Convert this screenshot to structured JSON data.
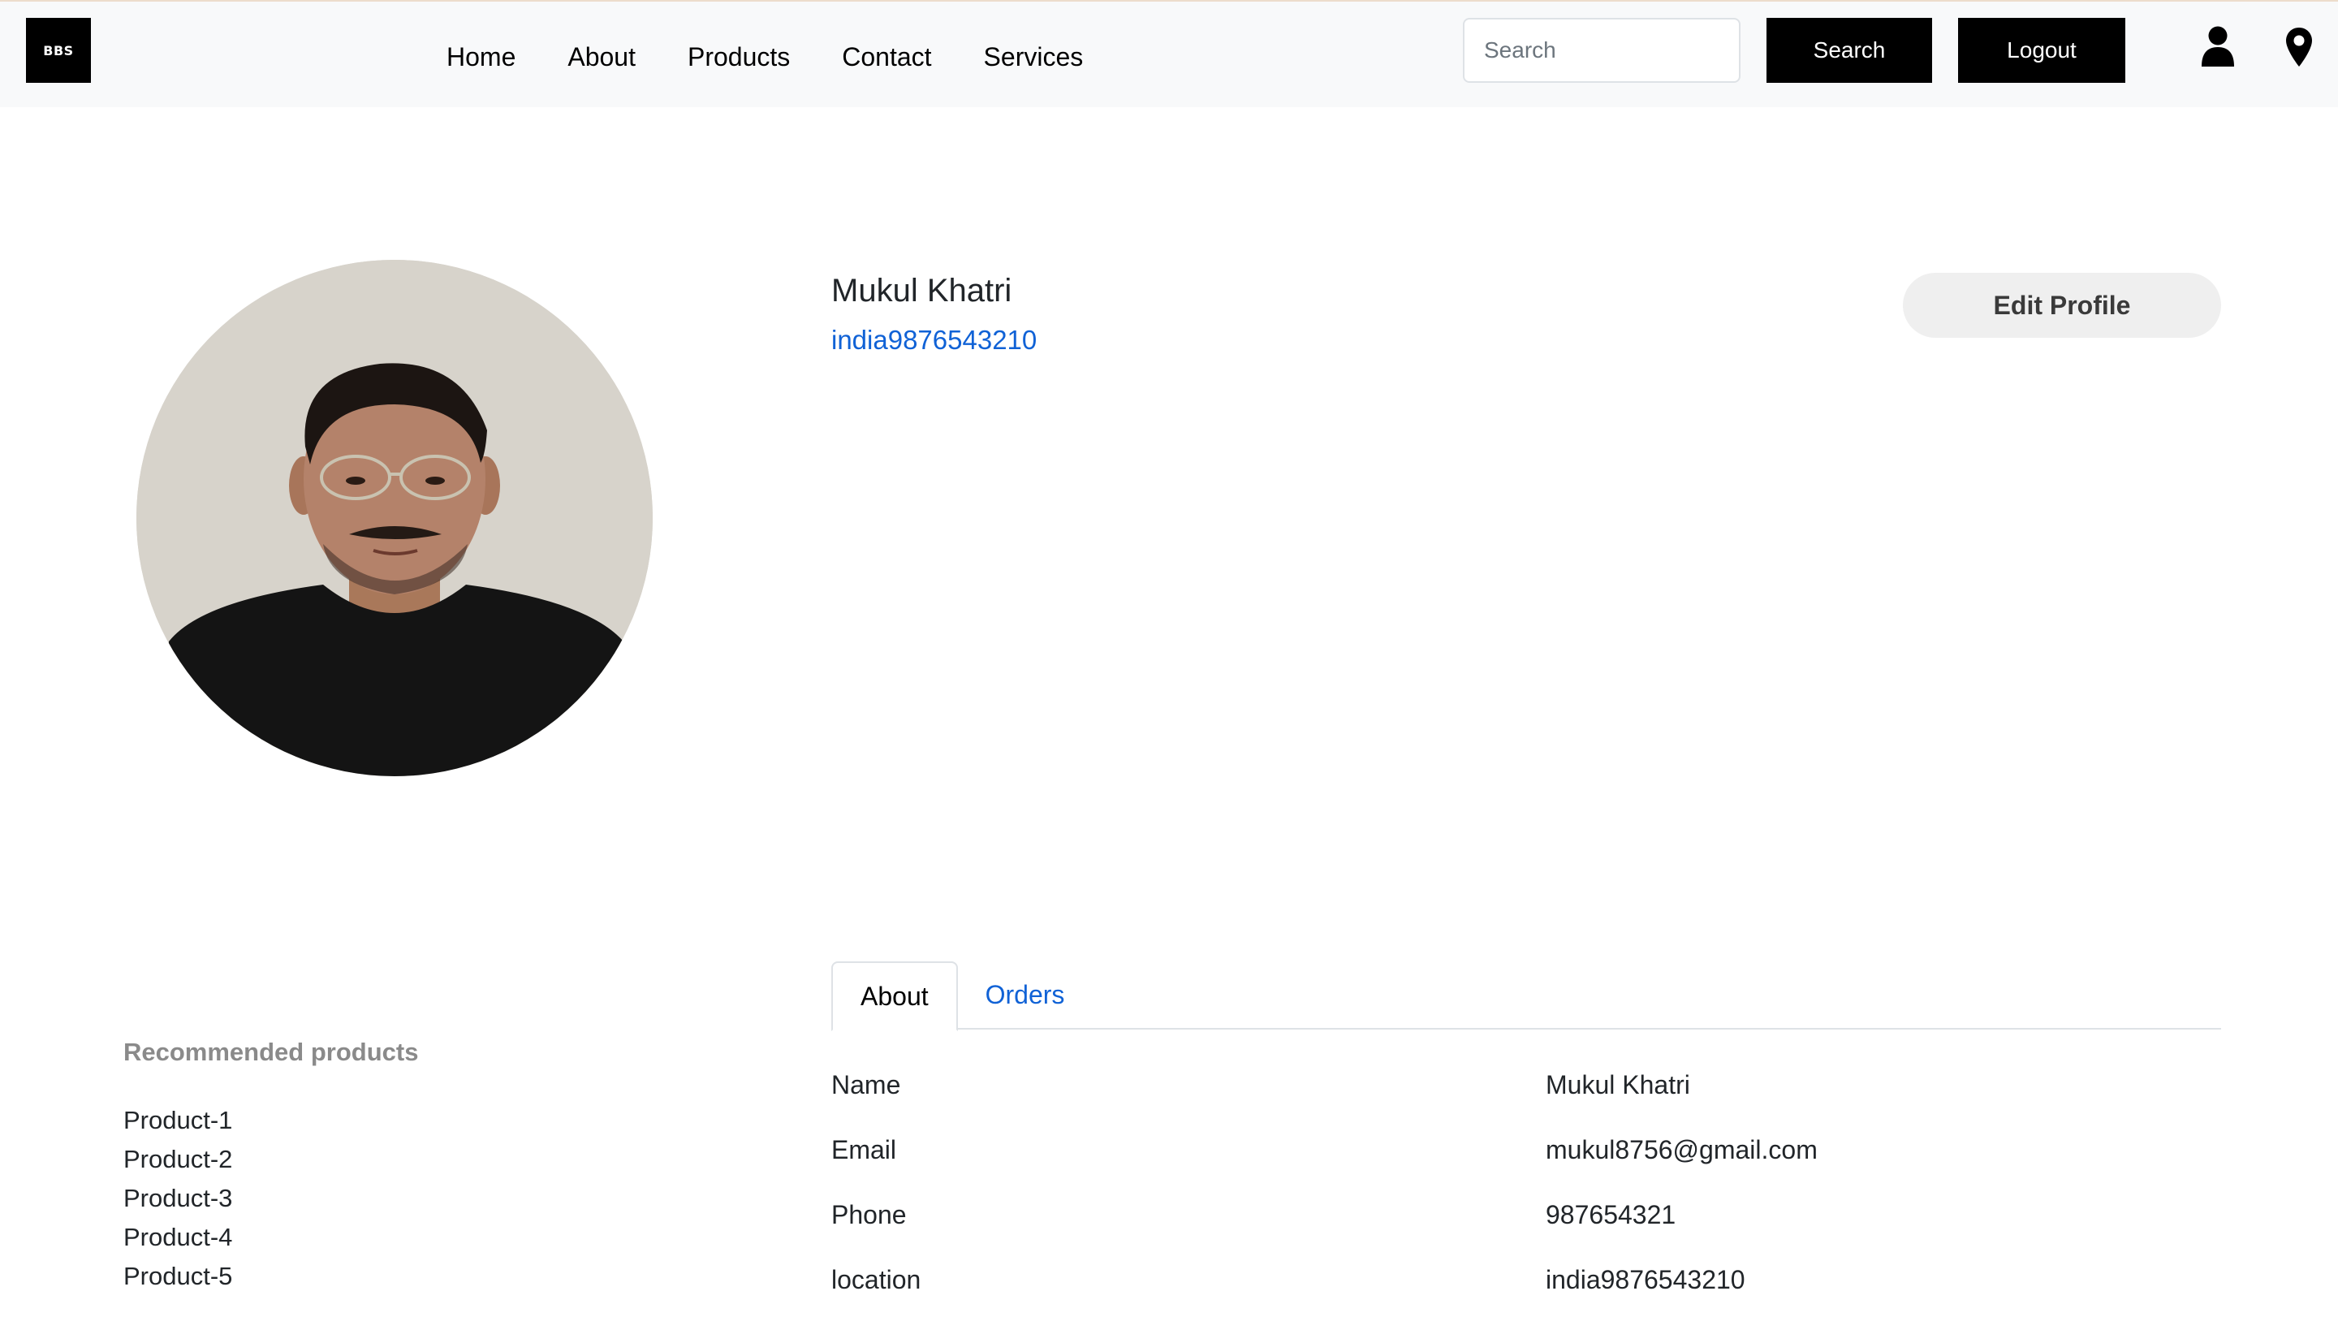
{
  "navbar": {
    "logo_text": "BBS",
    "links": [
      {
        "label": "Home"
      },
      {
        "label": "About"
      },
      {
        "label": "Products"
      },
      {
        "label": "Contact"
      },
      {
        "label": "Services"
      }
    ],
    "search": {
      "placeholder": "Search",
      "value": ""
    },
    "search_button": "Search",
    "logout_button": "Logout",
    "icons": [
      "user-icon",
      "location-pin-icon"
    ]
  },
  "profile": {
    "name": "Mukul Khatri",
    "subtitle": "india9876543210",
    "edit_button": "Edit Profile",
    "avatar": "profile-photo"
  },
  "recommended": {
    "title": "Recommended products",
    "items": [
      "Product-1",
      "Product-2",
      "Product-3",
      "Product-4",
      "Product-5"
    ]
  },
  "tabs": [
    {
      "label": "About",
      "active": true
    },
    {
      "label": "Orders",
      "active": false
    }
  ],
  "details": [
    {
      "label": "Name",
      "value": "Mukul Khatri"
    },
    {
      "label": "Email",
      "value": "mukul8756@gmail.com"
    },
    {
      "label": "Phone",
      "value": "987654321"
    },
    {
      "label": "location",
      "value": "india9876543210"
    }
  ],
  "colors": {
    "navbar_bg": "#f8f9fa",
    "link_blue": "#1062d6",
    "button_black": "#000000",
    "muted_heading": "#8a8a8a"
  }
}
